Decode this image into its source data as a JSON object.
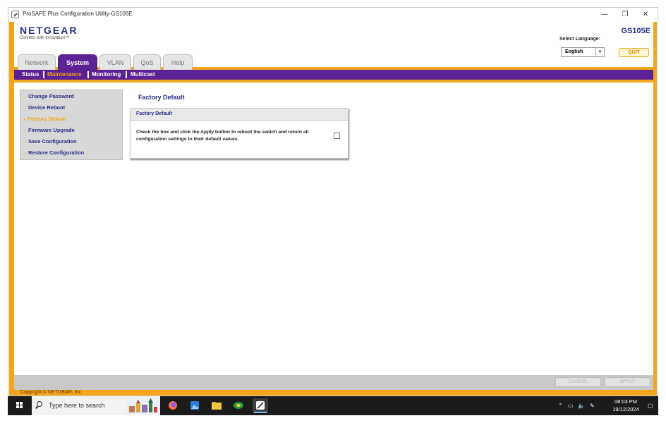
{
  "window": {
    "title": "ProSAFE Plus Configuration Utility-GS105E"
  },
  "window_controls": {
    "minimize": "—",
    "maximize": "❐",
    "close": "✕"
  },
  "header": {
    "brand": "NETGEAR",
    "tagline": "Connect with Innovation™",
    "model": "GS105E",
    "language_label": "Select Language:",
    "language_value": "English",
    "quit_label": "QUIT"
  },
  "tabs": [
    {
      "label": "Network",
      "active": false
    },
    {
      "label": "System",
      "active": true
    },
    {
      "label": "VLAN",
      "active": false
    },
    {
      "label": "QoS",
      "active": false
    },
    {
      "label": "Help",
      "active": false
    }
  ],
  "subnav": [
    {
      "label": "Status",
      "active": false
    },
    {
      "label": "Maintenance",
      "active": true
    },
    {
      "label": "Monitoring",
      "active": false
    },
    {
      "label": "Multicast",
      "active": false
    }
  ],
  "sidemenu": [
    {
      "label": "Change Password",
      "active": false
    },
    {
      "label": "Device Reboot",
      "active": false
    },
    {
      "label": "Factory Default",
      "active": true
    },
    {
      "label": "Firmware Upgrade",
      "active": false
    },
    {
      "label": "Save Configuration",
      "active": false
    },
    {
      "label": "Restore Configuration",
      "active": false
    }
  ],
  "main": {
    "page_title": "Factory Default",
    "panel_title": "Factory Default",
    "panel_text": "Check the box and click the Apply button to reboot the switch and return all configuration settings to their default values.",
    "checkbox_checked": false
  },
  "footer": {
    "cancel_label": "CANCEL",
    "apply_label": "APPLY",
    "copyright": "Copyright © NETGEAR, Inc."
  },
  "taskbar": {
    "search_placeholder": "Type here to search",
    "apps": [
      "firefox-icon",
      "photos-icon",
      "file-explorer-icon",
      "network-tool-icon",
      "prosafe-utility-icon"
    ],
    "time": "08:03 PM",
    "date": "19/12/2024"
  },
  "colors": {
    "brand_navy": "#2a2e84",
    "accent_orange": "#f3a51c",
    "nav_purple": "#5c2192"
  }
}
